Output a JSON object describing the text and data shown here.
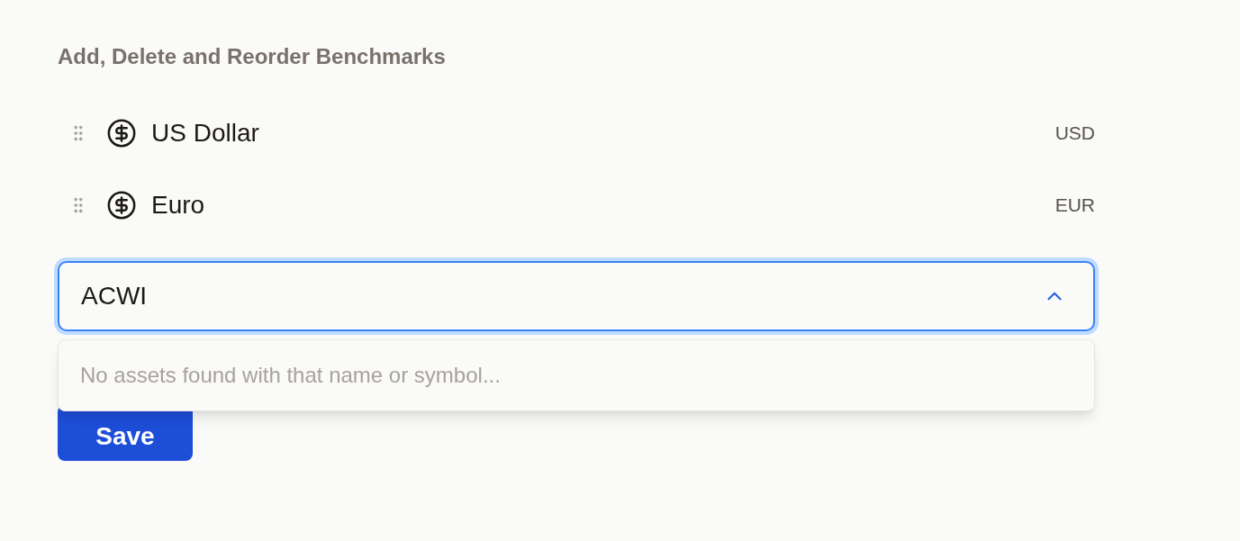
{
  "heading": "Add, Delete and Reorder Benchmarks",
  "benchmarks": [
    {
      "name": "US Dollar",
      "symbol": "USD"
    },
    {
      "name": "Euro",
      "symbol": "EUR"
    }
  ],
  "search": {
    "value": "ACWI",
    "expanded": true
  },
  "dropdown": {
    "message": "No assets found with that name or symbol..."
  },
  "save_button": "Save"
}
